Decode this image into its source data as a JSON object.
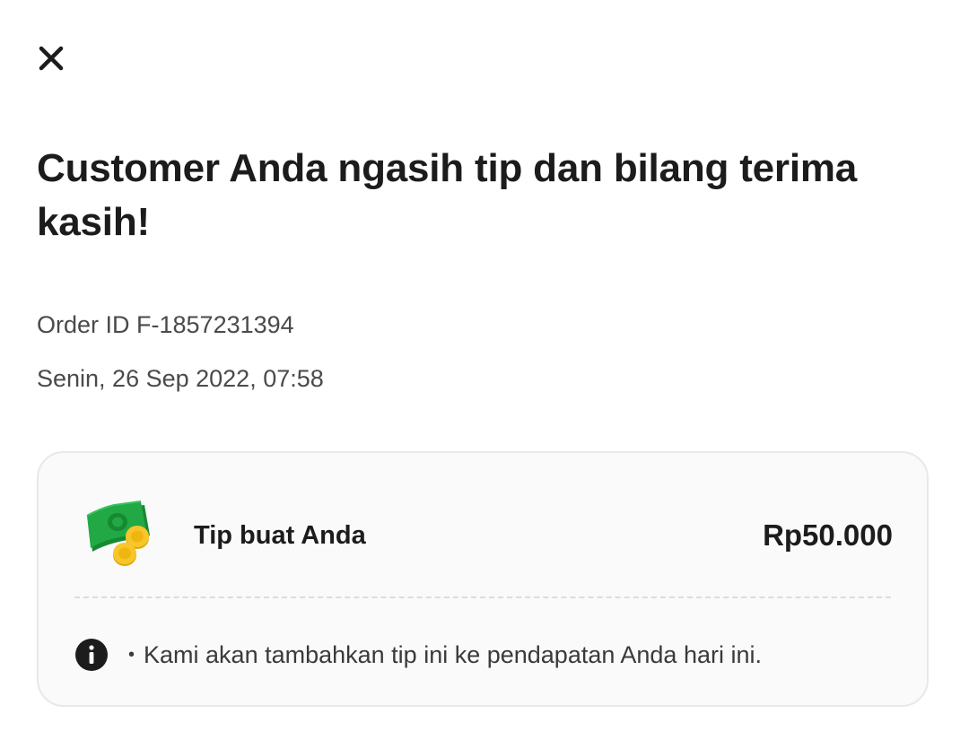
{
  "header": {
    "close_icon": "close-icon"
  },
  "title": "Customer Anda ngasih tip dan bilang terima kasih!",
  "order": {
    "id_text": "Order ID F-1857231394",
    "datetime": "Senin, 26 Sep 2022, 07:58"
  },
  "tip_card": {
    "icon": "money-coins-icon",
    "label": "Tip buat Anda",
    "amount": "Rp50.000",
    "info_icon": "info-icon",
    "info_bullet": "•",
    "info_text": "Kami akan tambahkan tip ini ke pendapatan Anda hari ini."
  },
  "colors": {
    "text_primary": "#1c1c1c",
    "text_secondary": "#4a4a4a",
    "card_background": "#fafafa",
    "card_border": "#e8e8e8",
    "money_green": "#1f9a3a",
    "coin_gold": "#f5c518"
  }
}
